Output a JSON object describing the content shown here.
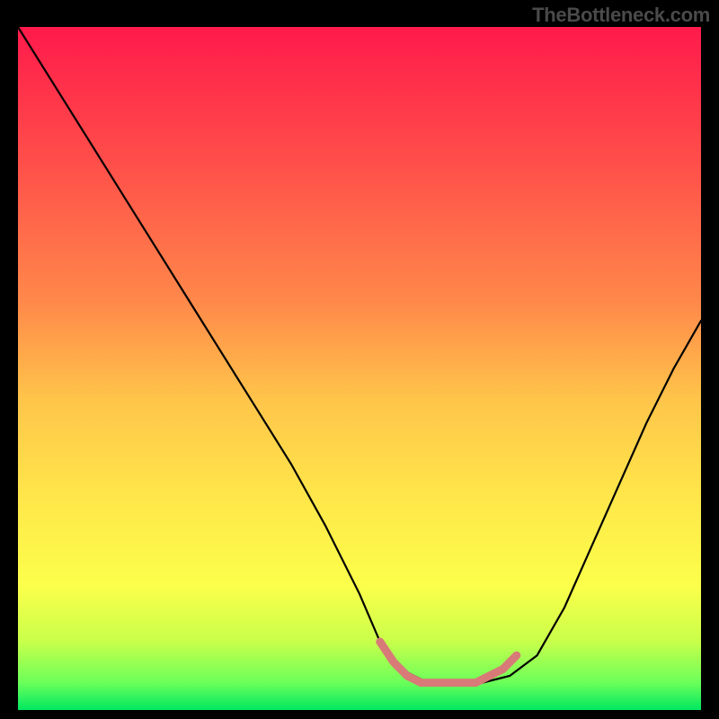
{
  "watermark": "TheBottleneck.com",
  "chart_data": {
    "type": "line",
    "title": "",
    "xlabel": "",
    "ylabel": "",
    "xlim": [
      0,
      100
    ],
    "ylim": [
      0,
      100
    ],
    "gradient_stops": [
      {
        "offset": 0,
        "color": "#ff1a4b"
      },
      {
        "offset": 0.2,
        "color": "#ff4f4a"
      },
      {
        "offset": 0.4,
        "color": "#ff884a"
      },
      {
        "offset": 0.55,
        "color": "#ffc64a"
      },
      {
        "offset": 0.7,
        "color": "#ffe94a"
      },
      {
        "offset": 0.82,
        "color": "#fbff4a"
      },
      {
        "offset": 0.9,
        "color": "#c8ff4a"
      },
      {
        "offset": 0.96,
        "color": "#6bff5a"
      },
      {
        "offset": 1.0,
        "color": "#00e860"
      }
    ],
    "series": [
      {
        "name": "bottleneck-curve",
        "x": [
          0,
          5,
          10,
          15,
          20,
          25,
          30,
          35,
          40,
          45,
          50,
          53,
          56,
          60,
          64,
          68,
          72,
          76,
          80,
          84,
          88,
          92,
          96,
          100
        ],
        "y": [
          100,
          92,
          84,
          76,
          68,
          60,
          52,
          44,
          36,
          27,
          17,
          10,
          6,
          4,
          4,
          4,
          5,
          8,
          15,
          24,
          33,
          42,
          50,
          57
        ],
        "color": "#000000"
      },
      {
        "name": "optimal-zone",
        "x": [
          53,
          55,
          57,
          59,
          61,
          63,
          65,
          67,
          69,
          71,
          73
        ],
        "y": [
          10,
          7,
          5,
          4,
          4,
          4,
          4,
          4,
          5,
          6,
          8
        ],
        "color": "#d87a78"
      }
    ]
  }
}
